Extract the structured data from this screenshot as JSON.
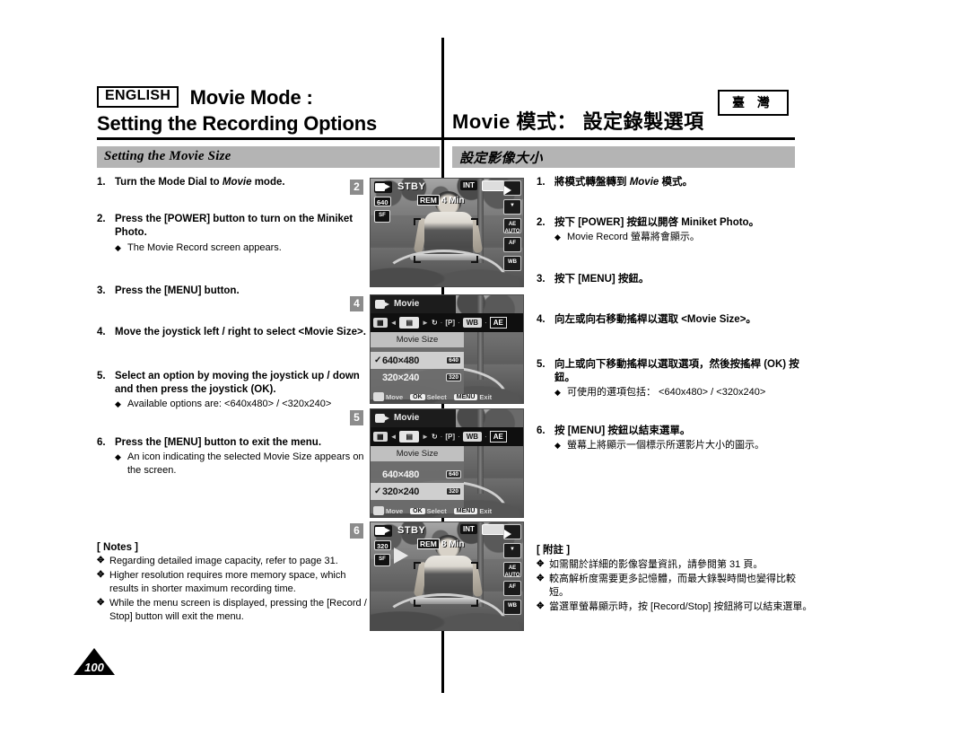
{
  "header": {
    "language_badge": "ENGLISH",
    "title_en_line1": "Movie Mode :",
    "title_en_line2": "Setting the Recording Options",
    "title_zh": "Movie 模式： 設定錄製選項",
    "region_badge": "臺 灣"
  },
  "section": {
    "title_en": "Setting the Movie Size",
    "title_zh": "設定影像大小"
  },
  "steps_en": [
    {
      "num": "1.",
      "text": "Turn the Mode Dial to <i>Movie</i> mode.",
      "subs": []
    },
    {
      "num": "2.",
      "text": "Press the [POWER] button to turn on the Miniket Photo.",
      "subs": [
        "The Movie Record screen appears."
      ]
    },
    {
      "num": "3.",
      "text": "Press the [MENU] button.",
      "subs": []
    },
    {
      "num": "4.",
      "text": "Move the joystick left / right to select &lt;Movie Size&gt;.",
      "subs": []
    },
    {
      "num": "5.",
      "text": "Select an option by moving the joystick up / down and then press the joystick (OK).",
      "subs": [
        "Available options are: <640x480> / <320x240>"
      ]
    },
    {
      "num": "6.",
      "text": "Press the [MENU] button to exit the menu.",
      "subs": [
        "An icon indicating the selected Movie Size appears on the screen."
      ]
    }
  ],
  "steps_zh": [
    {
      "num": "1.",
      "text": "將模式轉盤轉到 <i>Movie</i> 模式。",
      "subs": []
    },
    {
      "num": "2.",
      "text": "按下 [POWER] 按鈕以開啓 Miniket Photo。",
      "subs": [
        "Movie Record 螢幕將會顯示。"
      ]
    },
    {
      "num": "3.",
      "text": "按下 [MENU] 按鈕。",
      "subs": []
    },
    {
      "num": "4.",
      "text": "向左或向右移動搖桿以選取 &lt;Movie Size&gt;。",
      "subs": []
    },
    {
      "num": "5.",
      "text": "向上或向下移動搖桿以選取選項，然後按搖桿 (OK) 按鈕。",
      "subs": [
        "可使用的選項包括： <640x480> / <320x240>"
      ]
    },
    {
      "num": "6.",
      "text": "按 [MENU] 按鈕以結束選單。",
      "subs": [
        "螢幕上將顯示一個標示所選影片大小的圖示。"
      ]
    }
  ],
  "notes_en": {
    "title": "[ Notes ]",
    "items": [
      "Regarding detailed image capacity, refer to page 31.",
      "Higher resolution requires more memory space, which results in shorter maximum recording time.",
      "While the menu screen is displayed, pressing the [Record / Stop] button will exit the menu."
    ]
  },
  "notes_zh": {
    "title": "[ 附註 ]",
    "items": [
      "如需關於詳細的影像容量資訊，請參閱第 31 頁。",
      "較高解析度需要更多記憶體，而最大錄製時間也變得比較短。",
      "當選單螢幕顯示時，按 [Record/Stop] 按鈕將可以結束選單。"
    ]
  },
  "page_number": "100",
  "badges": [
    "2",
    "4",
    "5",
    "6"
  ],
  "screens": {
    "record_stby_1": {
      "badge": "2",
      "mode_label": "STBY",
      "resolution_icon": "640",
      "quality_icon": "SF",
      "rem_tag": "REM",
      "rem_value": "4 Min",
      "memory_label": "INT",
      "right_icons": [
        "play-icon",
        "mic-icon",
        "AE",
        "focus-icon",
        "white-balance-icon"
      ]
    },
    "menu_640": {
      "badge": "4",
      "menu_title": "Movie",
      "submenu_title": "Movie Size",
      "options": [
        {
          "label": "640×480",
          "icon": "640",
          "selected": true
        },
        {
          "label": "320×240",
          "icon": "320",
          "selected": false
        }
      ],
      "bottom": [
        {
          "key": "joystick",
          "label": "Move"
        },
        {
          "key": "OK",
          "label": "Select"
        },
        {
          "key": "MENU",
          "label": "Exit"
        }
      ]
    },
    "menu_320": {
      "badge": "5",
      "menu_title": "Movie",
      "submenu_title": "Movie Size",
      "options": [
        {
          "label": "640×480",
          "icon": "640",
          "selected": false
        },
        {
          "label": "320×240",
          "icon": "320",
          "selected": true
        }
      ],
      "bottom": [
        {
          "key": "joystick",
          "label": "Move"
        },
        {
          "key": "OK",
          "label": "Select"
        },
        {
          "key": "MENU",
          "label": "Exit"
        }
      ]
    },
    "record_stby_2": {
      "badge": "6",
      "mode_label": "STBY",
      "resolution_icon": "320",
      "quality_icon": "SF",
      "rem_tag": "REM",
      "rem_value": "8 Min",
      "memory_label": "INT",
      "right_icons": [
        "play-icon",
        "mic-icon",
        "AE",
        "focus-icon",
        "white-balance-icon"
      ]
    }
  },
  "colors": {
    "section_bar": "#b4b4b4",
    "badge_bg": "#8c8c8c",
    "rule": "#000000"
  }
}
